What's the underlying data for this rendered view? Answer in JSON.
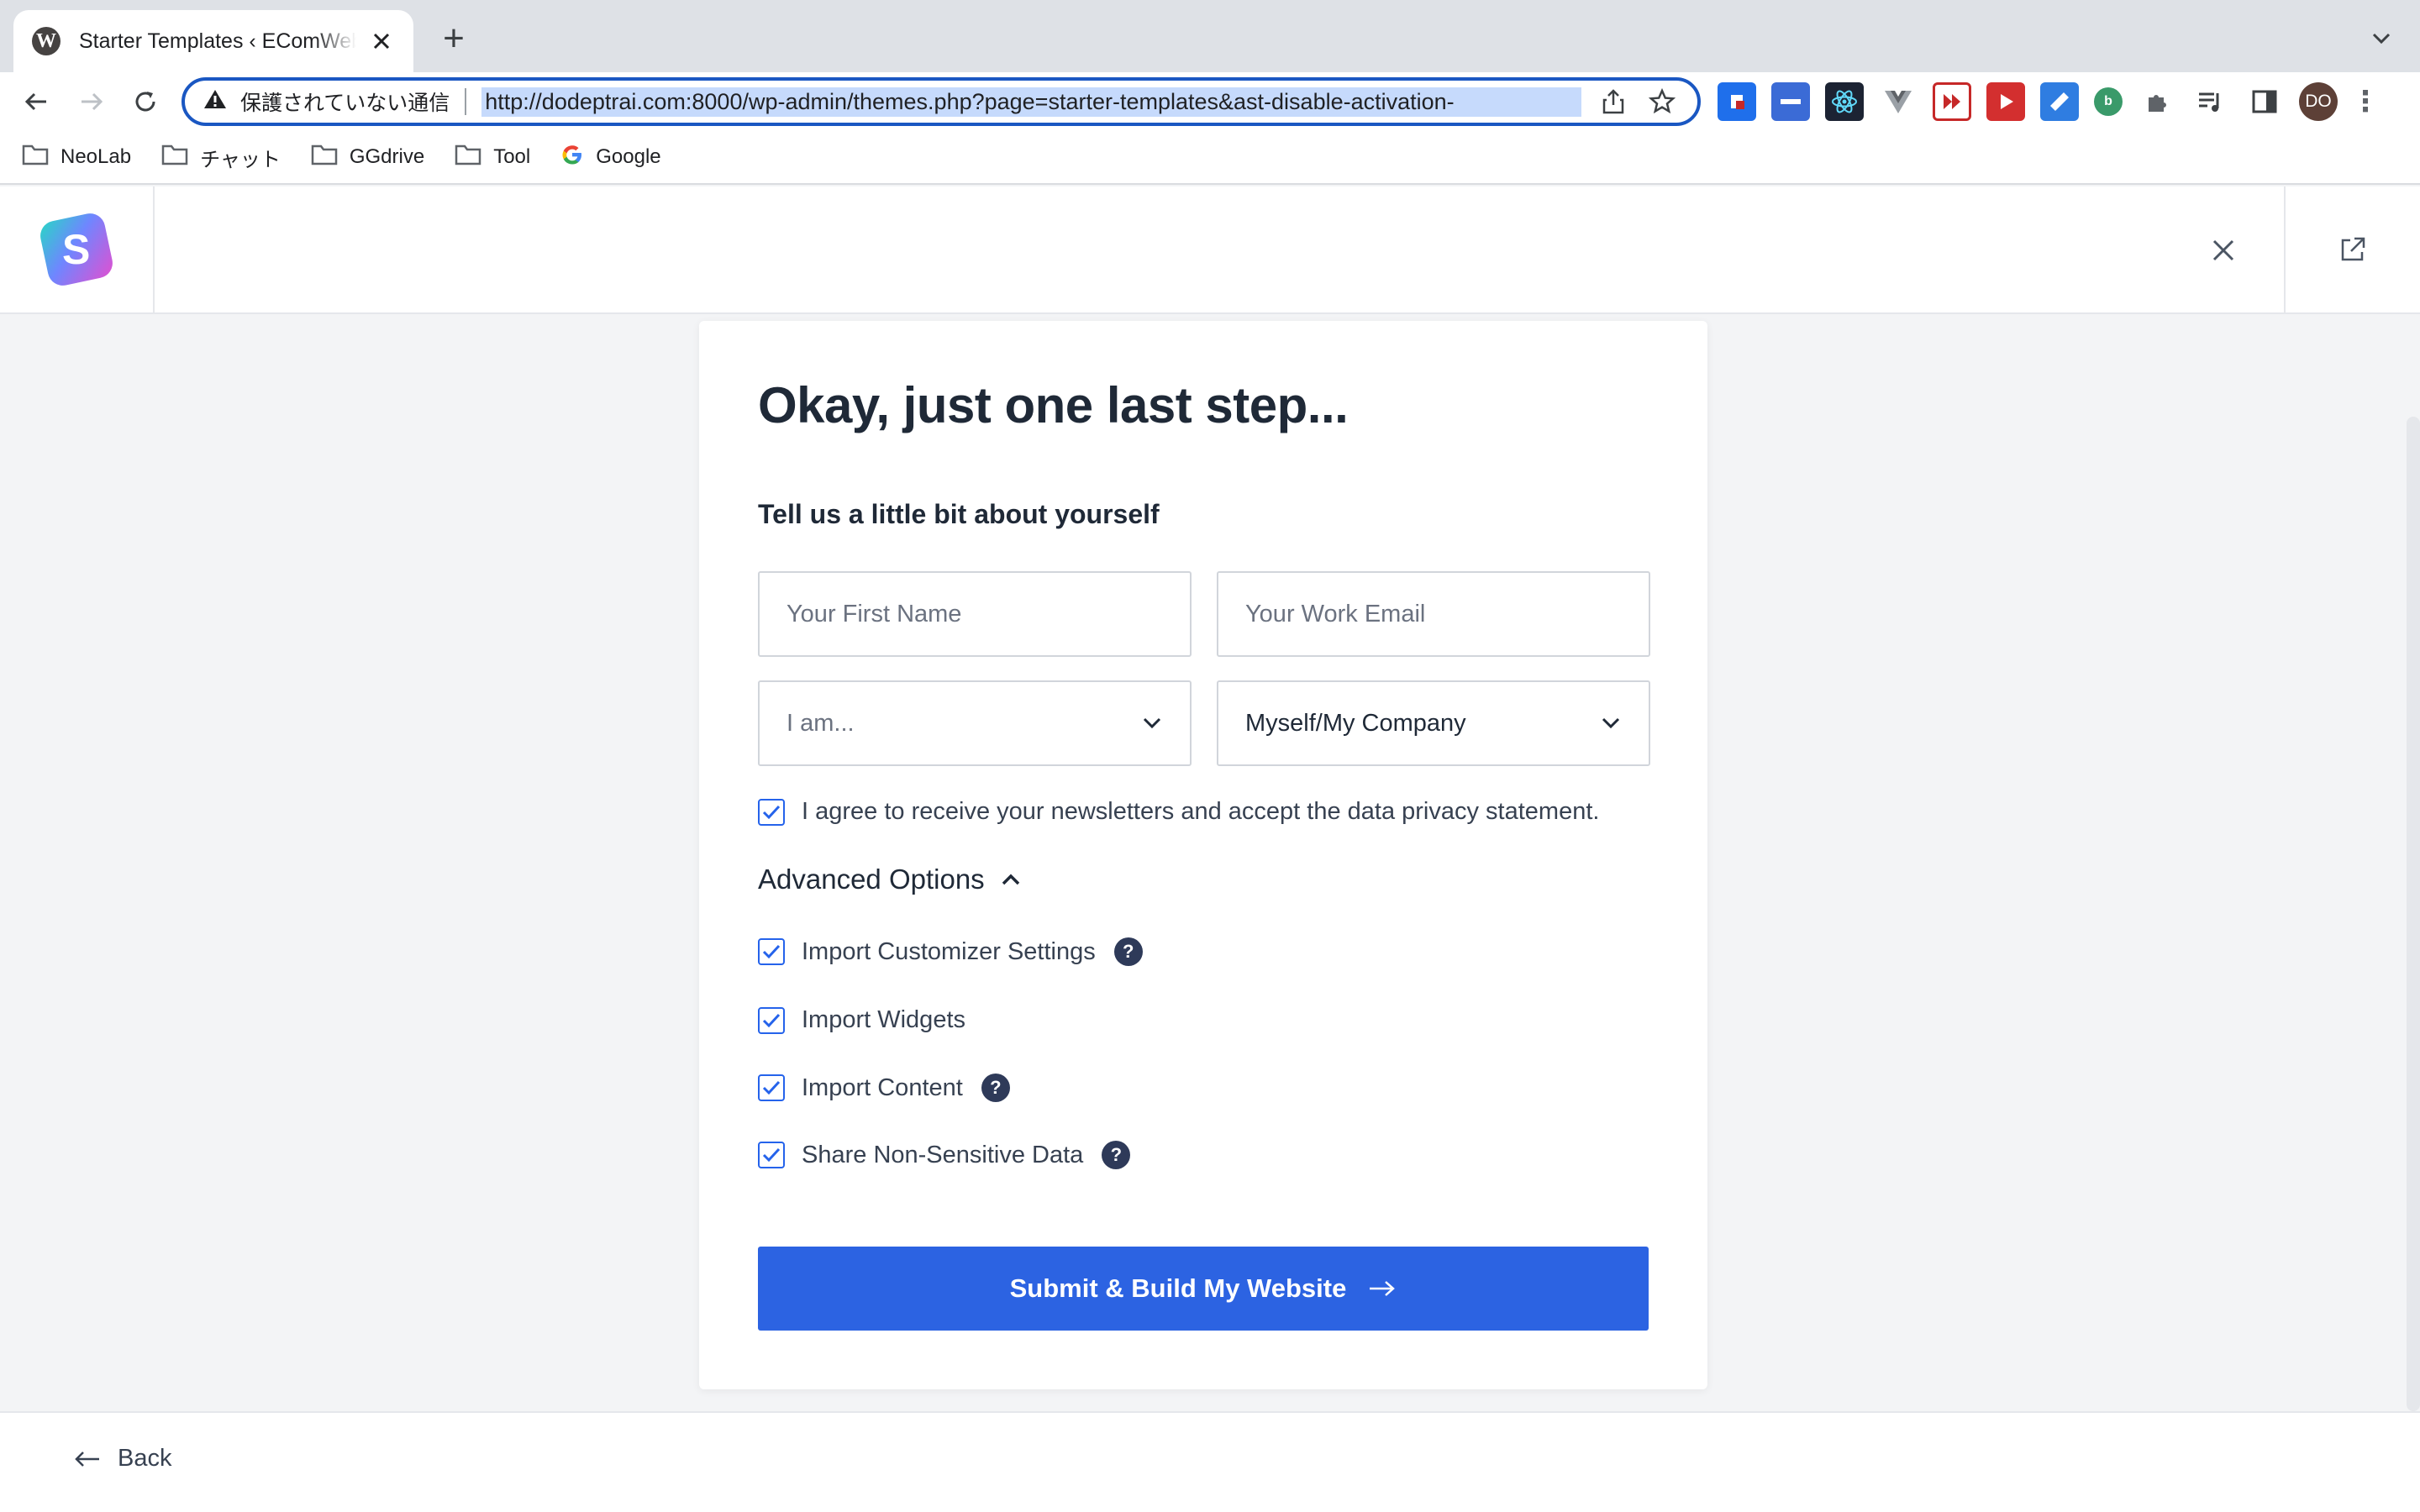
{
  "browser": {
    "tab_title": "Starter Templates ‹ EComWebsite",
    "new_tab_symbol": "+",
    "security_label": "保護されていない通信",
    "url": "http://dodeptrai.com:8000/wp-admin/themes.php?page=starter-templates&ast-disable-activation-",
    "profile_initials": "DO",
    "bookmarks": [
      "NeoLab",
      "チャット",
      "GGdrive",
      "Tool",
      "Google"
    ]
  },
  "form": {
    "title": "Okay, just one last step...",
    "subtitle": "Tell us a little bit about yourself",
    "first_name_placeholder": "Your First Name",
    "email_placeholder": "Your Work Email",
    "role_select": "I am...",
    "company_select": "Myself/My Company",
    "newsletter_label": "I agree to receive your newsletters and accept the data privacy statement.",
    "newsletter_checked": true,
    "advanced_title": "Advanced Options",
    "options": [
      {
        "label": "Import Customizer Settings",
        "checked": true,
        "help": true
      },
      {
        "label": "Import Widgets",
        "checked": true,
        "help": false
      },
      {
        "label": "Import Content",
        "checked": true,
        "help": true
      },
      {
        "label": "Share Non-Sensitive Data",
        "checked": true,
        "help": true
      }
    ],
    "help_symbol": "?",
    "submit_label": "Submit & Build My Website"
  },
  "footer": {
    "back_label": "Back"
  },
  "colors": {
    "accent": "#2c63e2",
    "omnibox_border": "#1a57c2"
  }
}
